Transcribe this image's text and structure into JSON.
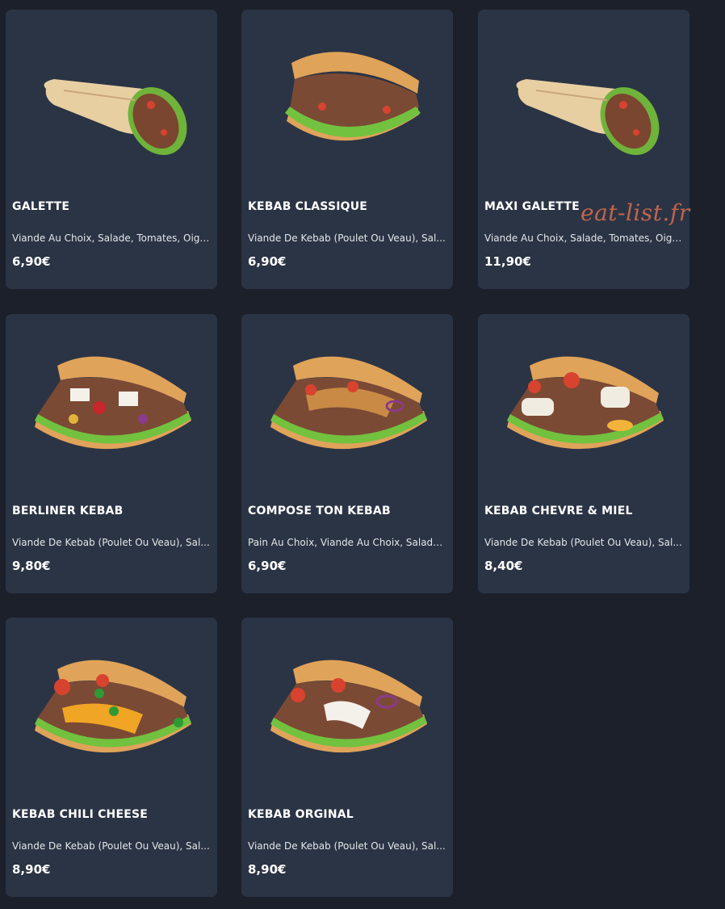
{
  "watermark": "eat-list.fr",
  "colors": {
    "page_bg": "#1b202a",
    "card_bg": "#2b3445",
    "text": "#ffffff",
    "watermark": "#c0654c"
  },
  "products": [
    {
      "name": "GALETTE",
      "description": "Viande Au Choix, Salade, Tomates, Oign...",
      "price": "6,90€",
      "image": "wrap"
    },
    {
      "name": "KEBAB CLASSIQUE",
      "description": "Viande De Kebab (Poulet Ou Veau), Sal...",
      "price": "6,90€",
      "image": "kebab-classic"
    },
    {
      "name": "MAXI GALETTE",
      "description": "Viande Au Choix, Salade, Tomates, Oign...",
      "price": "11,90€",
      "image": "wrap"
    },
    {
      "name": "BERLINER KEBAB",
      "description": "Viande De Kebab (Poulet Ou Veau), Sal...",
      "price": "9,80€",
      "image": "kebab-berliner"
    },
    {
      "name": "COMPOSE TON KEBAB",
      "description": "Pain Au Choix, Viande Au Choix, Salade,...",
      "price": "6,90€",
      "image": "kebab-compose"
    },
    {
      "name": "KEBAB CHEVRE & MIEL",
      "description": "Viande De Kebab (Poulet Ou Veau), Sal...",
      "price": "8,40€",
      "image": "kebab-chevre"
    },
    {
      "name": "KEBAB CHILI CHEESE",
      "description": "Viande De Kebab (Poulet Ou Veau), Sal...",
      "price": "8,90€",
      "image": "kebab-chili"
    },
    {
      "name": "KEBAB ORGINAL",
      "description": "Viande De Kebab (Poulet Ou Veau), Sal...",
      "price": "8,90€",
      "image": "kebab-original"
    }
  ]
}
